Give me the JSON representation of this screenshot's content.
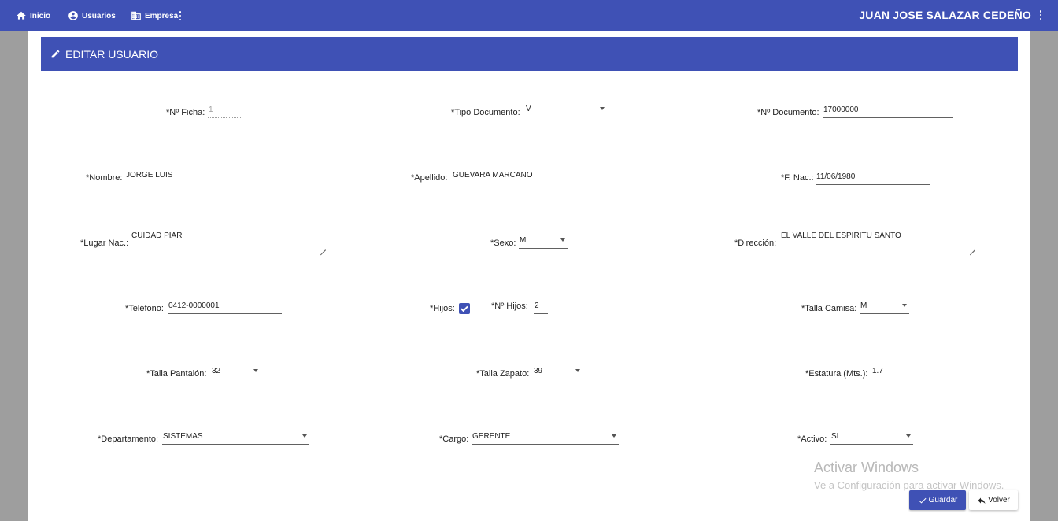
{
  "nav": {
    "home_label": "Inicio",
    "users_label": "Usuarios",
    "company_label": "Empresa",
    "user_name": "JUAN JOSE SALAZAR CEDEÑO"
  },
  "card": {
    "title": "EDITAR USUARIO"
  },
  "form": {
    "ficha": {
      "label": "*Nº Ficha:",
      "value": "1"
    },
    "tipo_documento": {
      "label": "*Tipo Documento:",
      "value": "V"
    },
    "num_documento": {
      "label": "*Nº Documento:",
      "value": "17000000"
    },
    "nombre": {
      "label": "*Nombre:",
      "value": "JORGE LUIS"
    },
    "apellido": {
      "label": "*Apellido:",
      "value": "GUEVARA MARCANO"
    },
    "fecha_nac": {
      "label": "*F. Nac.:",
      "value": "11/06/1980"
    },
    "lugar_nac": {
      "label": "*Lugar Nac.:",
      "value": "CUIDAD PIAR"
    },
    "sexo": {
      "label": "*Sexo:",
      "value": "M"
    },
    "direccion": {
      "label": "*Dirección:",
      "value": "EL VALLE DEL ESPIRITU SANTO"
    },
    "telefono": {
      "label": "*Teléfono:",
      "value": "0412-0000001"
    },
    "hijos": {
      "label": "*Hijos:",
      "checked": true
    },
    "num_hijos": {
      "label": "*Nº Hijos:",
      "value": "2"
    },
    "talla_camisa": {
      "label": "*Talla Camisa:",
      "value": "M"
    },
    "talla_pantalon": {
      "label": "*Talla Pantalón:",
      "value": "32"
    },
    "talla_zapato": {
      "label": "*Talla Zapato:",
      "value": "39"
    },
    "estatura": {
      "label": "*Estatura (Mts.):",
      "value": "1.7"
    },
    "departamento": {
      "label": "*Departamento:",
      "value": "SISTEMAS"
    },
    "cargo": {
      "label": "*Cargo:",
      "value": "GERENTE"
    },
    "activo": {
      "label": "*Activo:",
      "value": "SI"
    }
  },
  "watermark": {
    "title": "Activar Windows",
    "subtitle": "Ve a Configuración para activar Windows."
  },
  "actions": {
    "save_label": "Guardar",
    "back_label": "Volver"
  },
  "colors": {
    "primary": "#3f51b5",
    "background": "#9e9e9e"
  }
}
